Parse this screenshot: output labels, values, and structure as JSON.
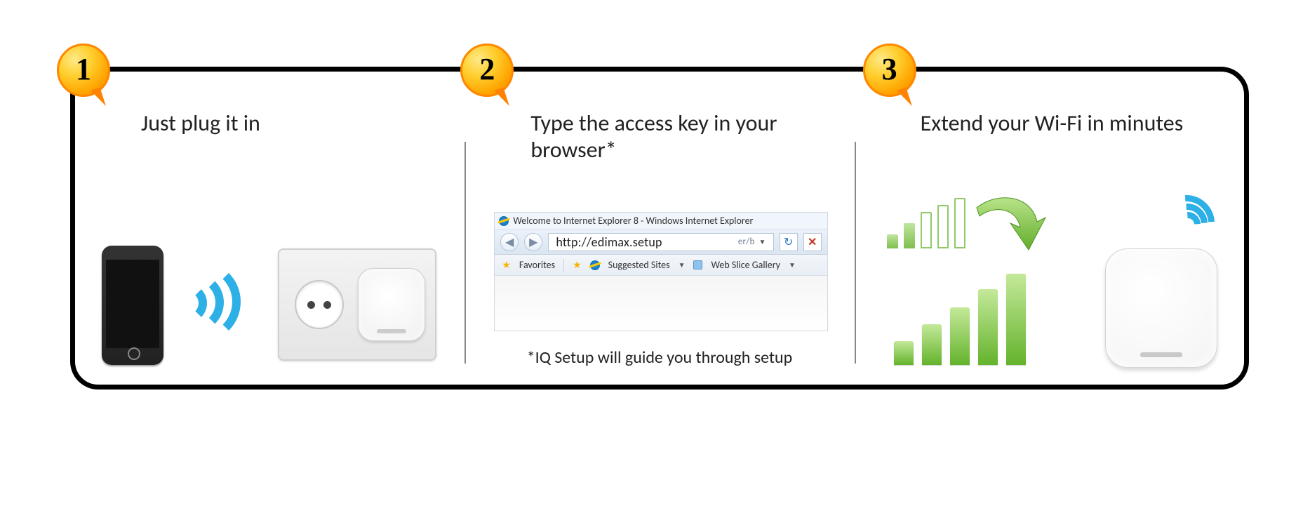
{
  "steps": [
    {
      "num": "1",
      "title": "Just plug it in"
    },
    {
      "num": "2",
      "title": "Type the access key in your browser*",
      "footnote": "*IQ Setup will guide you through setup"
    },
    {
      "num": "3",
      "title": "Extend your Wi-Fi in minutes"
    }
  ],
  "browser": {
    "window_title": "Welcome to Internet Explorer 8 - Windows Internet Explorer",
    "url": "http://edimax.setup",
    "url_suffix": "er/b",
    "fav_label": "Favorites",
    "suggested_label": "Suggested Sites",
    "webslice_label": "Web Slice Gallery"
  }
}
